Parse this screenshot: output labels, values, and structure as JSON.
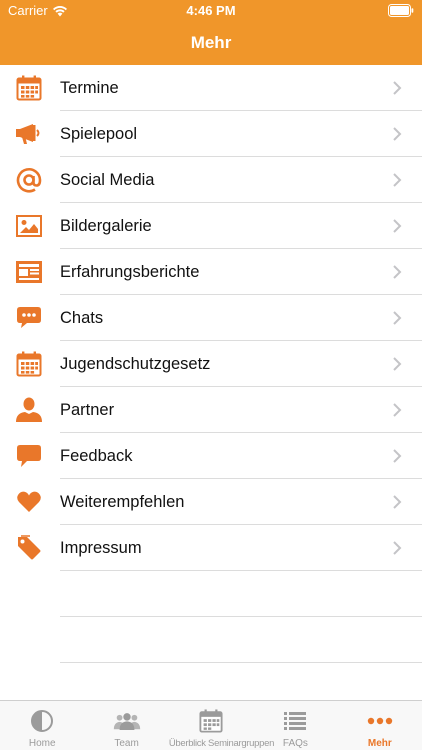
{
  "status_bar": {
    "carrier": "Carrier",
    "time": "4:46 PM"
  },
  "nav": {
    "title": "Mehr"
  },
  "colors": {
    "accent": "#F0962A",
    "icon_orange": "#E9772A",
    "tab_inactive": "#9b9b9b"
  },
  "menu": {
    "items": [
      {
        "label": "Termine",
        "icon": "calendar-icon"
      },
      {
        "label": "Spielepool",
        "icon": "megaphone-icon"
      },
      {
        "label": "Social Media",
        "icon": "at-sign-icon"
      },
      {
        "label": "Bildergalerie",
        "icon": "image-icon"
      },
      {
        "label": "Erfahrungsberichte",
        "icon": "newspaper-icon"
      },
      {
        "label": "Chats",
        "icon": "chat-bubble-icon"
      },
      {
        "label": "Jugendschutzgesetz",
        "icon": "calendar-icon"
      },
      {
        "label": "Partner",
        "icon": "person-icon"
      },
      {
        "label": "Feedback",
        "icon": "speech-bubble-icon"
      },
      {
        "label": "Weiterempfehlen",
        "icon": "heart-icon"
      },
      {
        "label": "Impressum",
        "icon": "tag-icon"
      }
    ]
  },
  "tabbar": {
    "tabs": [
      {
        "label": "Home",
        "icon": "half-circle-icon",
        "active": false
      },
      {
        "label": "Team",
        "icon": "people-icon",
        "active": false
      },
      {
        "label": "Überblick Seminargruppen",
        "icon": "calendar-icon",
        "active": false
      },
      {
        "label": "FAQs",
        "icon": "list-icon",
        "active": false
      },
      {
        "label": "Mehr",
        "icon": "more-dots-icon",
        "active": true
      }
    ]
  }
}
